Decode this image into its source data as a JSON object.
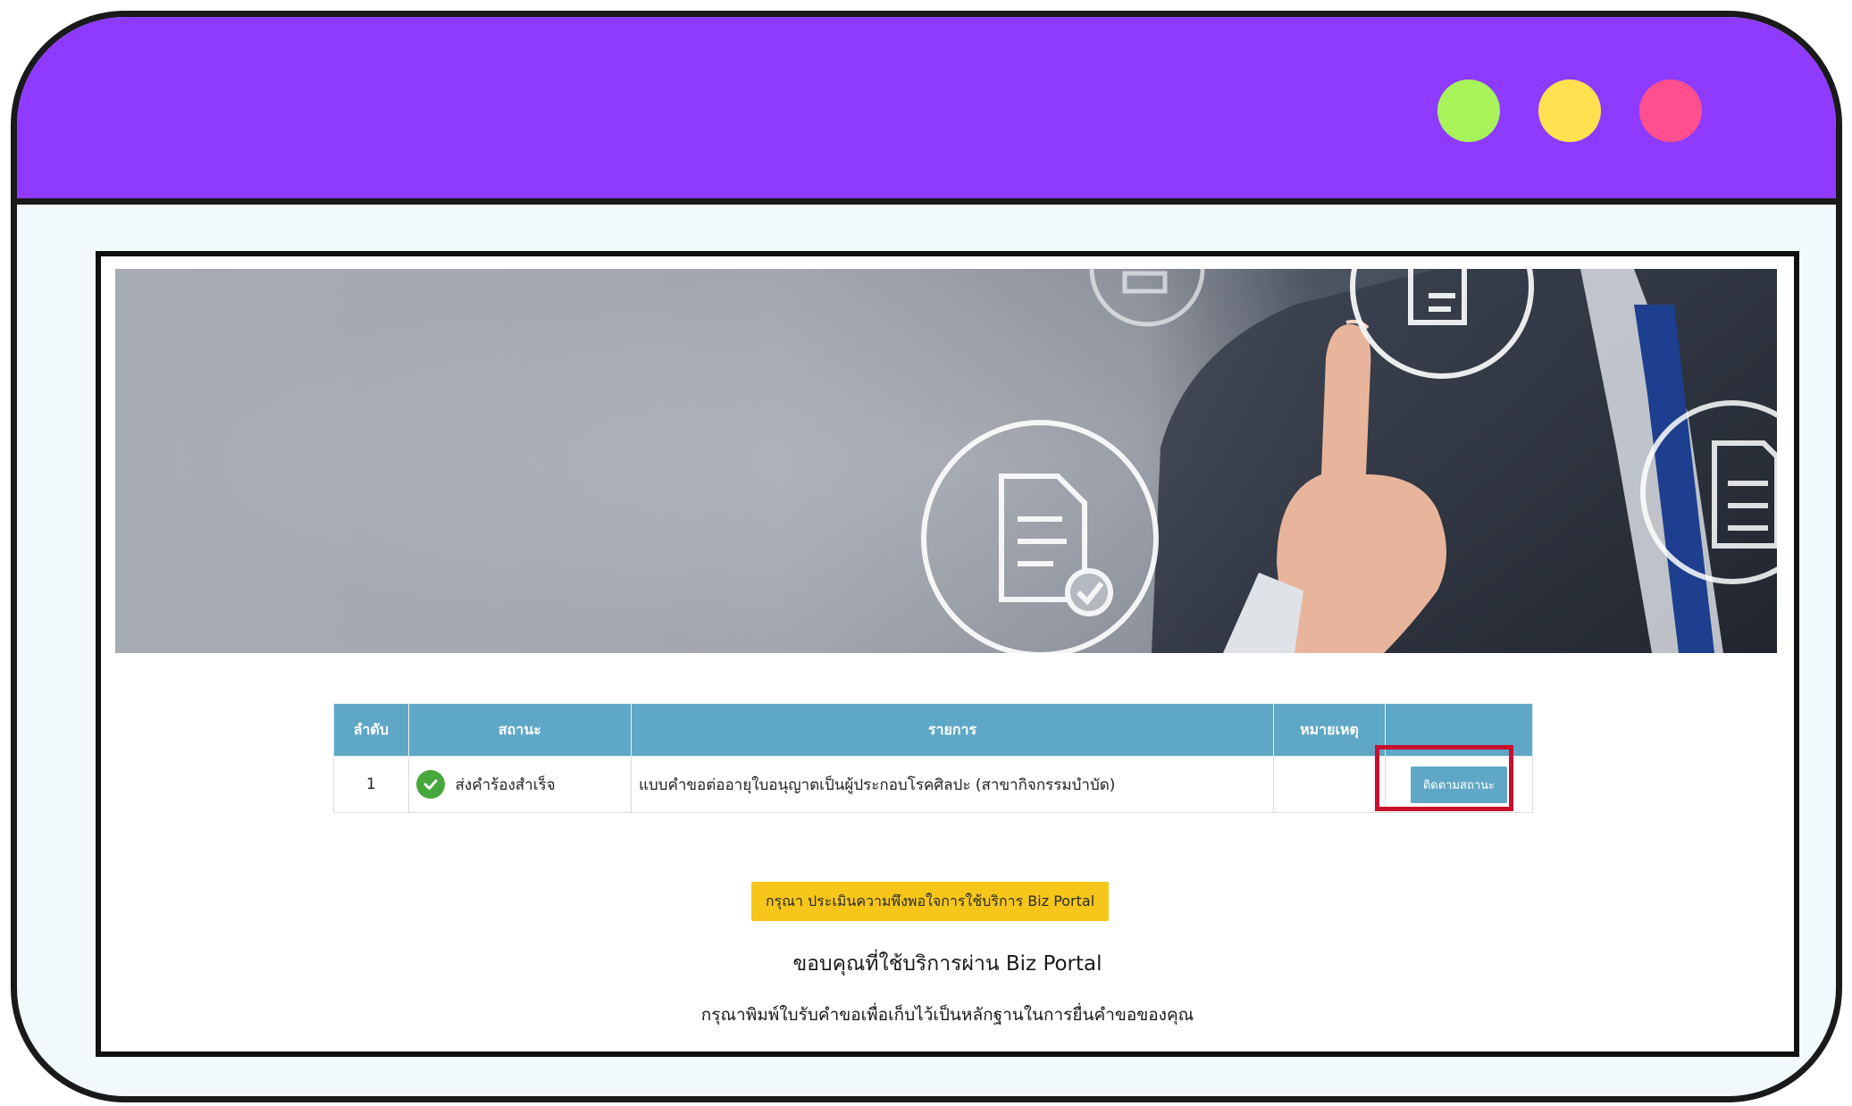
{
  "window": {
    "dots": [
      {
        "name": "green-dot",
        "color": "#a8f25a"
      },
      {
        "name": "yellow-dot",
        "color": "#ffe14f"
      },
      {
        "name": "pink-dot",
        "color": "#ff4f8e"
      }
    ],
    "titlebar_color": "#8e3bff"
  },
  "table": {
    "headers": {
      "no": "ลำดับ",
      "status": "สถานะ",
      "item": "รายการ",
      "note": "หมายเหตุ",
      "action": ""
    },
    "rows": [
      {
        "no": "1",
        "status": "ส่งคำร้องสำเร็จ",
        "item": "แบบคำขอต่ออายุใบอนุญาตเป็นผู้ประกอบโรคศิลปะ (สาขากิจกรรมบำบัด)",
        "note": "",
        "action_label": "ติดตามสถานะ"
      }
    ],
    "header_color": "#5fa7c6"
  },
  "survey_button": "กรุณา ประเมินความพึงพอใจการใช้บริการ Biz Portal",
  "thanks_text": "ขอบคุณที่ใช้บริการผ่าน Biz Portal",
  "print_note": "กรุณาพิมพ์ใบรับคำขอเพื่อเก็บไว้เป็นหลักฐานในการยื่นคำขอของคุณ",
  "banner": {
    "icons": [
      "document-icon",
      "document-check-icon",
      "document-edit-icon"
    ]
  },
  "highlight_color": "#c8102e"
}
